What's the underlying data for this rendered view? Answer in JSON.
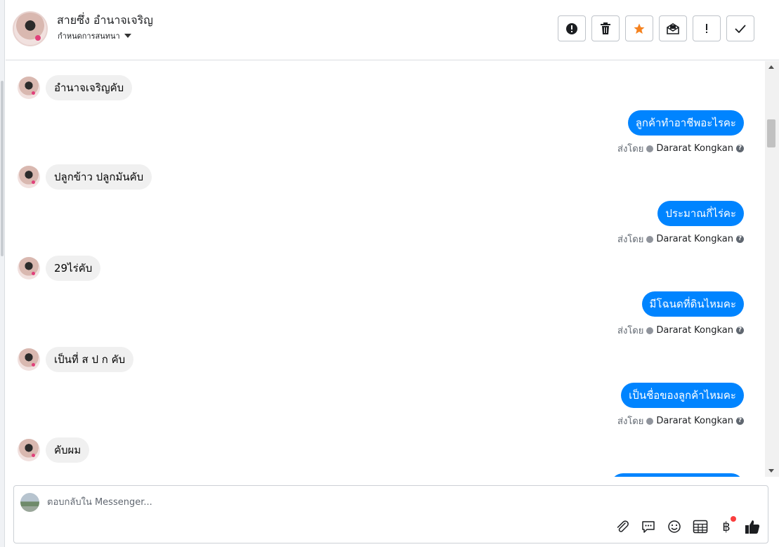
{
  "header": {
    "name": "สายซึ่ง อำนาจเจริญ",
    "sub": "กำหนดการสนทนา"
  },
  "toolbar": {
    "buttons": [
      {
        "name": "spam-button",
        "icon": "alert-circle-icon"
      },
      {
        "name": "delete-button",
        "icon": "trash-icon"
      },
      {
        "name": "star-button",
        "icon": "star-icon",
        "color": "#f5821f"
      },
      {
        "name": "mark-unread-button",
        "icon": "envelope-icon"
      },
      {
        "name": "follow-up-button",
        "icon": "exclamation-icon"
      },
      {
        "name": "done-button",
        "icon": "checkmark-icon"
      }
    ]
  },
  "messages": [
    {
      "dir": "in",
      "text": "อำนาจเจริญคับ"
    },
    {
      "dir": "out",
      "text": "ลูกค้าทำอาชีพอะไรคะ",
      "sent_label": "ส่งโดย",
      "sender": "Dararat Kongkan"
    },
    {
      "dir": "in",
      "text": "ปลูกข้าว ปลูกมันคับ"
    },
    {
      "dir": "out",
      "text": "ประมาณกี่ไร่คะ",
      "sent_label": "ส่งโดย",
      "sender": "Dararat Kongkan"
    },
    {
      "dir": "in",
      "text": "29ไร่คับ"
    },
    {
      "dir": "out",
      "text": "มีโฉนดที่ดินไหมคะ",
      "sent_label": "ส่งโดย",
      "sender": "Dararat Kongkan"
    },
    {
      "dir": "in",
      "text": "เป็นที่ ส ป ก คับ"
    },
    {
      "dir": "out",
      "text": "เป็นชื่อของลูกค้าไหมคะ",
      "sent_label": "ส่งโดย",
      "sender": "Dararat Kongkan"
    },
    {
      "dir": "in",
      "text": "คับผม"
    }
  ],
  "composer": {
    "placeholder": "ตอบกลับใน Messenger...",
    "tools": [
      "attach-icon",
      "saved-reply-icon",
      "emoji-icon",
      "appointment-icon",
      "payment-icon",
      "like-icon"
    ],
    "payment_symbol": "฿"
  },
  "colors": {
    "accent": "#0084ff",
    "incoming_bubble": "#f0f0f0",
    "star": "#f5821f"
  }
}
